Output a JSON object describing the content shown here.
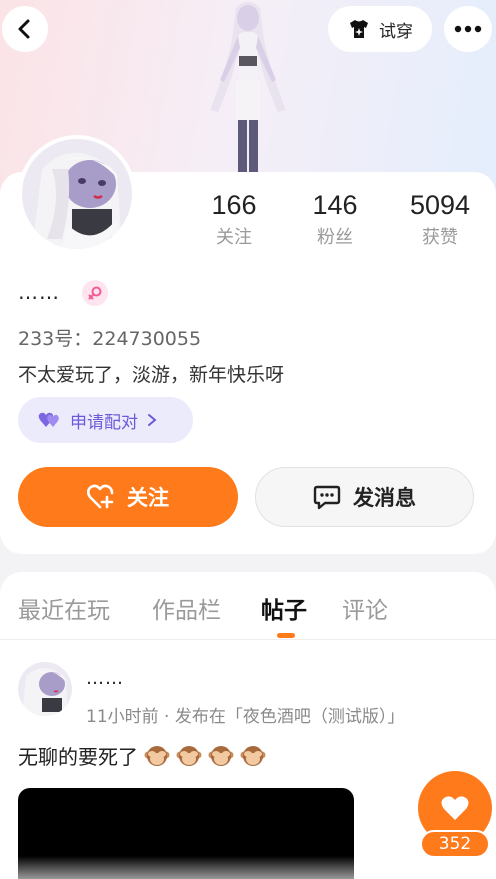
{
  "header": {
    "tryon_label": "试穿"
  },
  "profile": {
    "stats": [
      {
        "value": "166",
        "label": "关注"
      },
      {
        "value": "146",
        "label": "粉丝"
      },
      {
        "value": "5094",
        "label": "获赞"
      }
    ],
    "nickname": "……",
    "uid": "233号：224730055",
    "bio": "不太爱玩了，淡游，新年快乐呀",
    "match_label": "申请配对",
    "follow_label": "关注",
    "message_label": "发消息"
  },
  "tabs": [
    {
      "label": "最近在玩",
      "active": false
    },
    {
      "label": "作品栏",
      "active": false
    },
    {
      "label": "帖子",
      "active": true
    },
    {
      "label": "评论",
      "active": false
    }
  ],
  "post": {
    "author": "……",
    "meta": "11小时前 · 发布在「夜色酒吧（测试版）」",
    "text": "无聊的要死了",
    "emoji": [
      "see-no-evil-monkey",
      "see-no-evil-monkey",
      "see-no-evil-monkey",
      "see-no-evil-monkey"
    ],
    "like_count": "352"
  },
  "colors": {
    "accent": "#ff7a1a",
    "match_purple": "#6b5ad8"
  }
}
